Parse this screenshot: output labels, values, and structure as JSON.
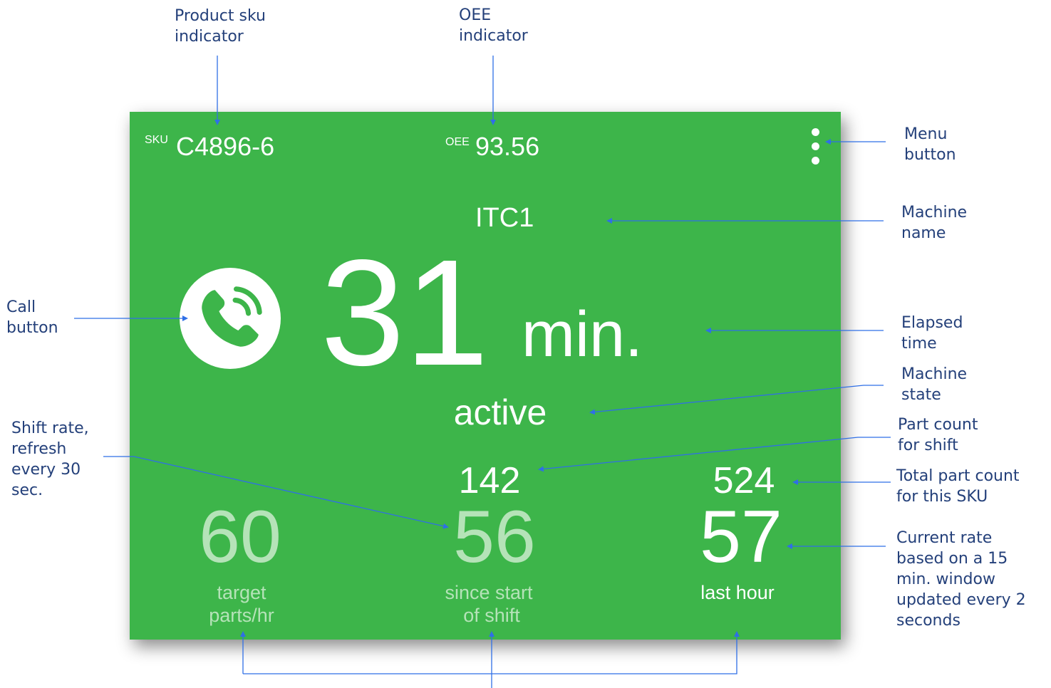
{
  "header": {
    "sku_label": "SKU",
    "sku_value": "C4896-6",
    "oee_label": "OEE",
    "oee_value": "93.56"
  },
  "machine": {
    "name": "ITC1",
    "elapsed_value": "31",
    "elapsed_unit": "min.",
    "state": "active"
  },
  "counts": {
    "shift_parts": "142",
    "sku_parts": "524"
  },
  "rates": {
    "target": {
      "value": "60",
      "label_line1": "target",
      "label_line2": "parts/hr"
    },
    "shift": {
      "value": "56",
      "label_line1": "since start",
      "label_line2": "of shift"
    },
    "current": {
      "value": "57",
      "label": "last hour"
    }
  },
  "annotations": {
    "sku": "Product sku\nindicator",
    "oee": "OEE\nindicator",
    "menu": "Menu\nbutton",
    "machine_name": "Machine\nname",
    "call": "Call\nbutton",
    "elapsed": "Elapsed\ntime",
    "machine_state": "Machine\nstate",
    "shift_rate": "Shift rate,\nrefresh\nevery 30\nsec.",
    "part_count_shift": "Part count\nfor shift",
    "total_part_count": "Total part count\nfor this SKU",
    "current_rate": "Current rate\nbased on a 15\nmin. window\nupdated every 2\nseconds"
  },
  "colors": {
    "panel_green": "#3db54a",
    "annotation_text": "#24407a",
    "connector_blue": "#2f6fe6",
    "faded_text": "#b5e3b8"
  }
}
